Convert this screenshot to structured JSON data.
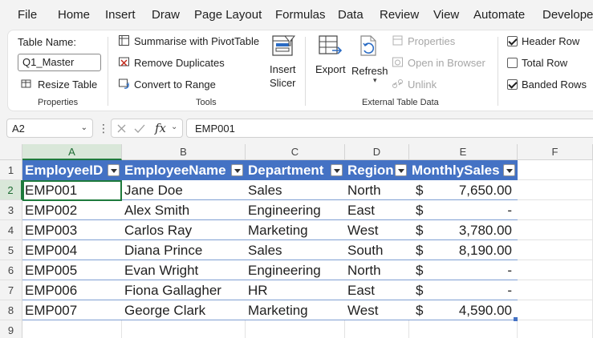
{
  "menu": [
    "File",
    "Home",
    "Insert",
    "Draw",
    "Page Layout",
    "Formulas",
    "Data",
    "Review",
    "View",
    "Automate",
    "Developer"
  ],
  "ribbon": {
    "properties": {
      "table_name_label": "Table Name:",
      "table_name_value": "Q1_Master",
      "resize_label": "Resize Table",
      "group_label": "Properties"
    },
    "tools": {
      "pivot_label": "Summarise with PivotTable",
      "dup_label": "Remove Duplicates",
      "range_label": "Convert to Range",
      "slicer_label_1": "Insert",
      "slicer_label_2": "Slicer",
      "group_label": "Tools"
    },
    "external": {
      "export_label": "Export",
      "refresh_label": "Refresh",
      "properties_label": "Properties",
      "browser_label": "Open in Browser",
      "unlink_label": "Unlink",
      "group_label": "External Table Data"
    },
    "style_options": {
      "header_row": {
        "label": "Header Row",
        "checked": true
      },
      "total_row": {
        "label": "Total Row",
        "checked": false
      },
      "banded_rows": {
        "label": "Banded Rows",
        "checked": true
      }
    }
  },
  "formula_bar": {
    "name_box": "A2",
    "fx": "fx",
    "value": "EMP001"
  },
  "grid": {
    "columns": [
      "A",
      "B",
      "C",
      "D",
      "E",
      "F"
    ],
    "rows": [
      "1",
      "2",
      "3",
      "4",
      "5",
      "6",
      "7",
      "8",
      "9"
    ],
    "headers": [
      "EmployeeID",
      "EmployeeName",
      "Department",
      "Region",
      "MonthlySales"
    ],
    "currency_symbol": "$",
    "data": [
      [
        "EMP001",
        "Jane Doe",
        "Sales",
        "North",
        "7,650.00"
      ],
      [
        "EMP002",
        "Alex Smith",
        "Engineering",
        "East",
        "-"
      ],
      [
        "EMP003",
        "Carlos Ray",
        "Marketing",
        "West",
        "3,780.00"
      ],
      [
        "EMP004",
        "Diana Prince",
        "Sales",
        "South",
        "8,190.00"
      ],
      [
        "EMP005",
        "Evan Wright",
        "Engineering",
        "North",
        "-"
      ],
      [
        "EMP006",
        "Fiona Gallagher",
        "HR",
        "East",
        "-"
      ],
      [
        "EMP007",
        "George Clark",
        "Marketing",
        "West",
        "4,590.00"
      ]
    ]
  },
  "colors": {
    "table_header": "#4472c4",
    "selection": "#1e7a3c"
  }
}
